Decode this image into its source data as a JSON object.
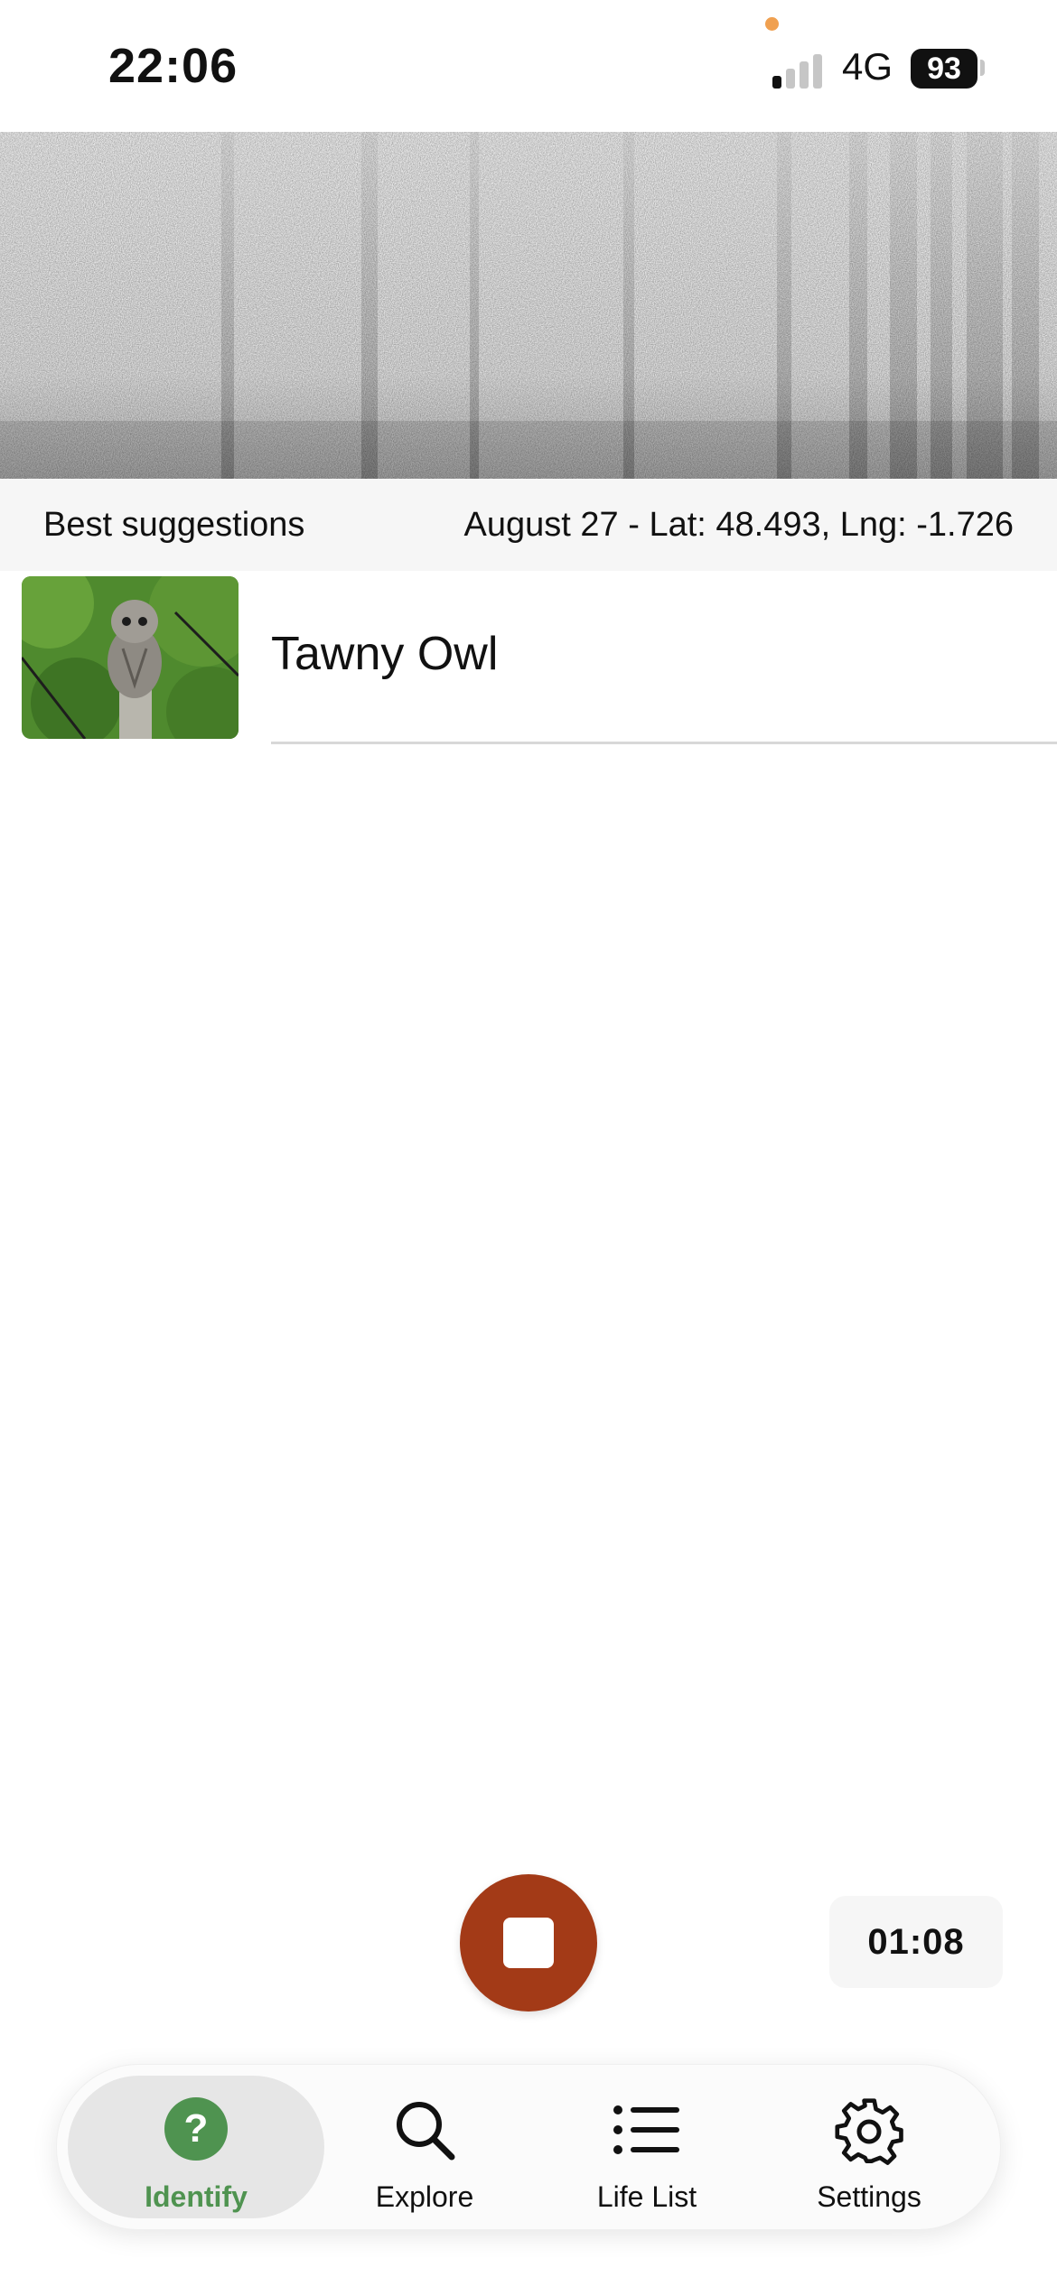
{
  "status_bar": {
    "time": "22:06",
    "network": "4G",
    "battery": "93"
  },
  "suggestions": {
    "title": "Best suggestions",
    "meta": "August 27 - Lat: 48.493, Lng: -1.726"
  },
  "results": [
    {
      "name": "Tawny Owl",
      "image_icon": "owl-photo"
    }
  ],
  "recording": {
    "timer": "01:08",
    "stop_icon": "stop-icon",
    "stop_color": "#a33a17"
  },
  "tabs": [
    {
      "label": "Identify",
      "icon": "help-icon",
      "active": true
    },
    {
      "label": "Explore",
      "icon": "search-icon",
      "active": false
    },
    {
      "label": "Life List",
      "icon": "list-icon",
      "active": false
    },
    {
      "label": "Settings",
      "icon": "gear-icon",
      "active": false
    }
  ],
  "colors": {
    "accent_green": "#4f9350",
    "record_red": "#a33a17"
  }
}
